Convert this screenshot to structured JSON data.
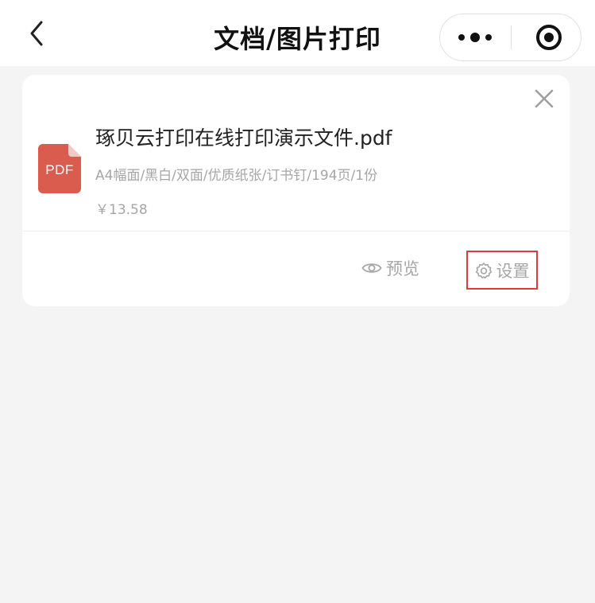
{
  "navbar": {
    "title": "文档/图片打印",
    "back_icon": "chevron-left-icon",
    "more_icon": "more-dots-icon",
    "close_icon": "target-circle-icon"
  },
  "file": {
    "name": "琢贝云打印在线打印演示文件.pdf",
    "icon_label": "PDF",
    "icon_color": "#d95c4f",
    "spec": "A4幅面/黑白/双面/优质纸张/订书钉/194页/1份",
    "price": "￥13.58"
  },
  "actions": {
    "preview_label": "预览",
    "preview_icon": "eye-icon",
    "settings_label": "设置",
    "settings_icon": "gear-icon",
    "highlight_color": "#e53935"
  },
  "colors": {
    "background": "#f4f4f4",
    "card": "#ffffff",
    "muted_text": "#a6a6a6"
  }
}
